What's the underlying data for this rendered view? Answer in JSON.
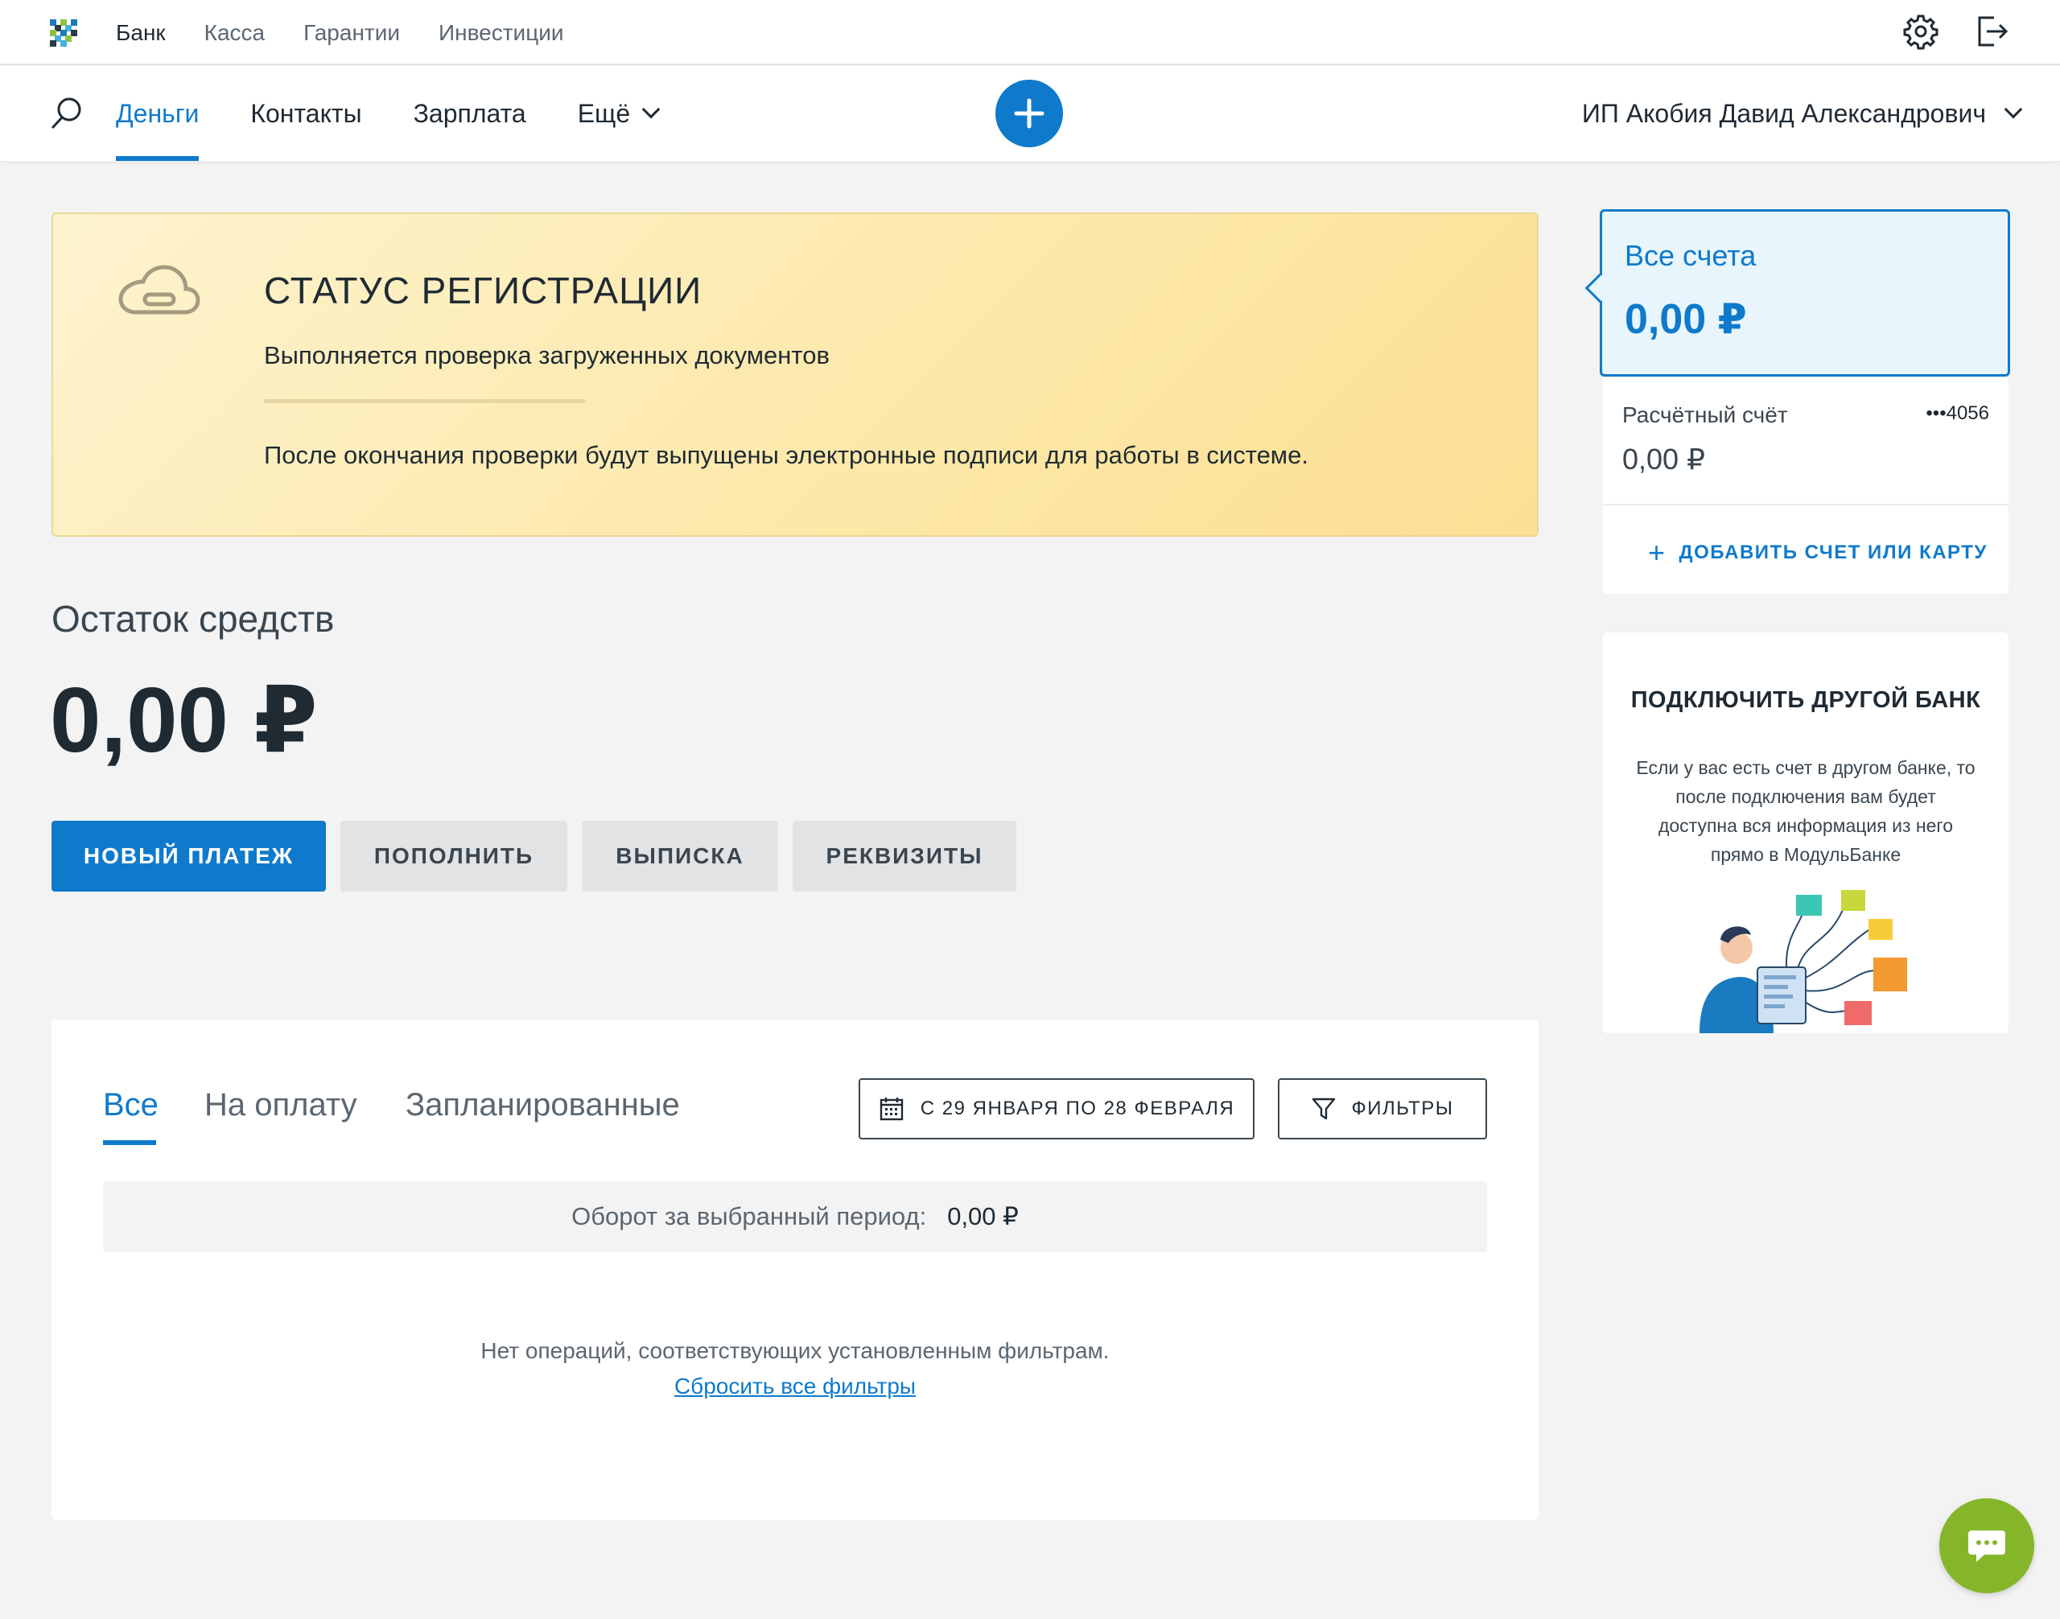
{
  "top_nav": {
    "items": [
      {
        "label": "Банк",
        "active": true
      },
      {
        "label": "Касса",
        "active": false
      },
      {
        "label": "Гарантии",
        "active": false
      },
      {
        "label": "Инвестиции",
        "active": false
      }
    ],
    "icons": [
      "settings-icon",
      "logout-icon"
    ]
  },
  "main_nav": {
    "items": [
      {
        "label": "Деньги",
        "active": true
      },
      {
        "label": "Контакты",
        "active": false
      },
      {
        "label": "Зарплата",
        "active": false
      },
      {
        "label": "Ещё",
        "active": false
      }
    ],
    "user": "ИП Акобия Давид Александрович"
  },
  "status": {
    "title": "СТАТУС РЕГИСТРАЦИИ",
    "subtitle": "Выполняется проверка загруженных документов",
    "note": "После окончания проверки будут выпущены электронные подписи для работы в системе."
  },
  "balance": {
    "label": "Остаток средств",
    "value": "0,00 ₽"
  },
  "actions": {
    "new_payment": "НОВЫЙ ПЛАТЕЖ",
    "top_up": "ПОПОЛНИТЬ",
    "statement": "ВЫПИСКА",
    "details": "РЕКВИЗИТЫ"
  },
  "operations": {
    "tabs": [
      {
        "label": "Все",
        "active": true
      },
      {
        "label": "На оплату",
        "active": false
      },
      {
        "label": "Запланированные",
        "active": false
      }
    ],
    "date_range": "С 29 ЯНВАРЯ ПО 28 ФЕВРАЛЯ",
    "filters": "ФИЛЬТРЫ",
    "turnover_label": "Оборот за выбранный период:",
    "turnover_value": "0,00 ₽",
    "empty_text": "Нет операций, соответствующих установленным фильтрам.",
    "reset_link": "Сбросить все фильтры"
  },
  "accounts": {
    "all_title": "Все счета",
    "all_value": "0,00 ₽",
    "items": [
      {
        "name": "Расчётный счёт",
        "number": "•••4056",
        "value": "0,00 ₽"
      }
    ],
    "add_label": "ДОБАВИТЬ СЧЕТ ИЛИ КАРТУ"
  },
  "other_bank": {
    "title": "ПОДКЛЮЧИТЬ ДРУГОЙ БАНК",
    "text": "Если у вас есть счет в другом банке, то после подключения вам будет доступна вся информация из него прямо в МодульБанке"
  },
  "colors": {
    "accent": "#0f7acb",
    "status_bg": "#fde8a8",
    "chat": "#85b62a"
  }
}
